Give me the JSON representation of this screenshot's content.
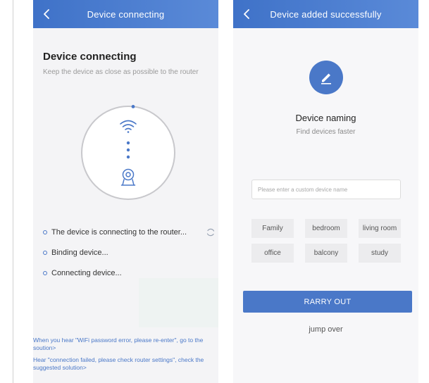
{
  "left_screen": {
    "navbar": {
      "title": "Device connecting",
      "back_icon": "chevron-left-icon"
    },
    "heading": "Device connecting",
    "subheading": "Keep the device as close as possible to the router",
    "illustration": {
      "icons": [
        "wifi-icon",
        "camera-icon"
      ]
    },
    "status_items": [
      {
        "label": "The device is connecting to the router...",
        "active": true
      },
      {
        "label": "Binding device..."
      },
      {
        "label": "Connecting device..."
      }
    ],
    "help_links": [
      "When you hear \"WiFi password error, please re-enter\", go to the soution>",
      "Hear \"connection failed, please check router settings\", check the suggested solution>"
    ]
  },
  "right_screen": {
    "navbar": {
      "title": "Device added successfully",
      "back_icon": "chevron-left-icon"
    },
    "edit_icon": "pencil-icon",
    "naming_title": "Device naming",
    "naming_subtitle": "Find devices faster",
    "name_input": {
      "value": "",
      "placeholder": "Please enter a custom device name"
    },
    "tags": [
      "Family",
      "bedroom",
      "living room",
      "office",
      "balcony",
      "study"
    ],
    "primary_button": "RARRY OUT",
    "secondary_link": "jump over"
  },
  "colors": {
    "accent": "#4a78c8",
    "navbar_start": "#3f72c8",
    "navbar_end": "#5a8ad8",
    "ring": "#c8c8cc"
  }
}
